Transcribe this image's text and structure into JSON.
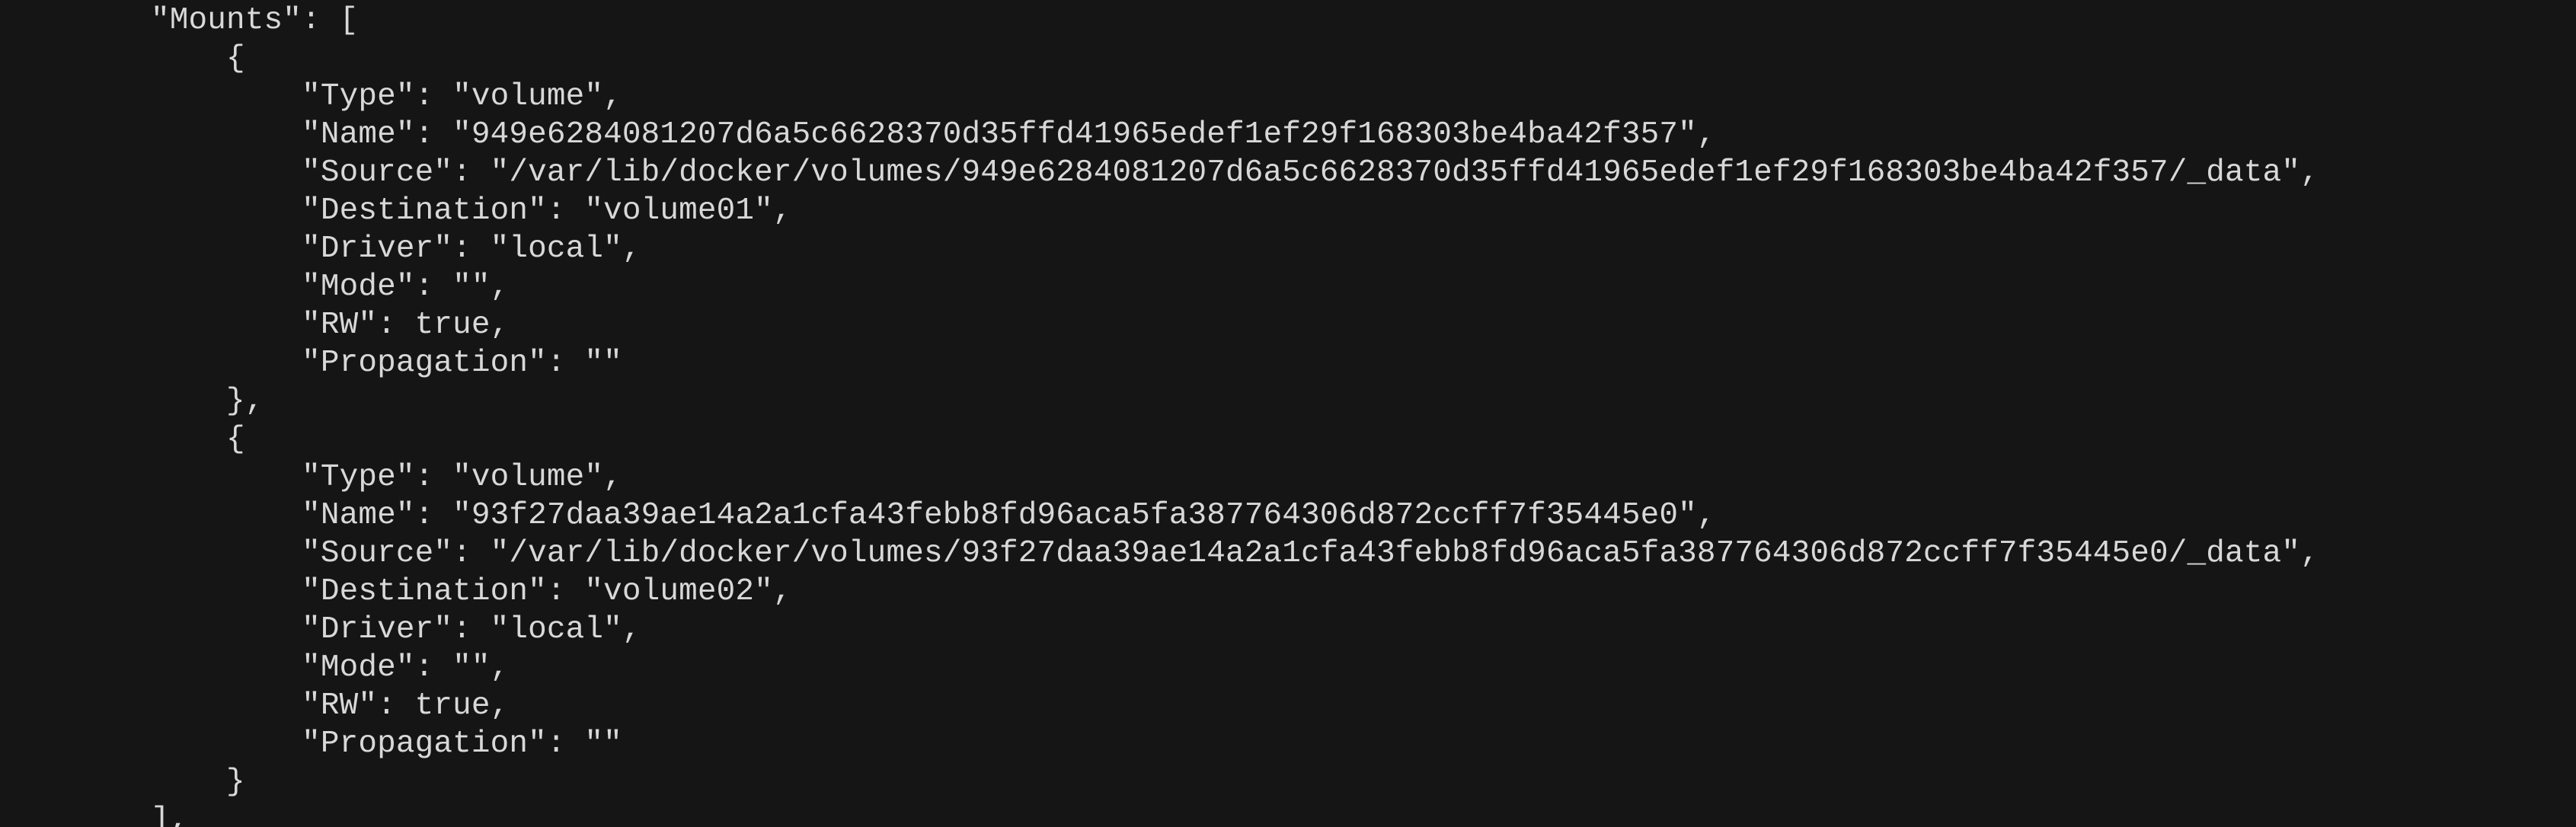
{
  "terminal": {
    "background": "#151515",
    "text_color": "#d8d8d8",
    "lines": [
      "        \"Mounts\": [",
      "            {",
      "                \"Type\": \"volume\",",
      "                \"Name\": \"949e6284081207d6a5c6628370d35ffd41965edef1ef29f168303be4ba42f357\",",
      "                \"Source\": \"/var/lib/docker/volumes/949e6284081207d6a5c6628370d35ffd41965edef1ef29f168303be4ba42f357/_data\",",
      "                \"Destination\": \"volume01\",",
      "                \"Driver\": \"local\",",
      "                \"Mode\": \"\",",
      "                \"RW\": true,",
      "                \"Propagation\": \"\"",
      "            },",
      "            {",
      "                \"Type\": \"volume\",",
      "                \"Name\": \"93f27daa39ae14a2a1cfa43febb8fd96aca5fa387764306d872ccff7f35445e0\",",
      "                \"Source\": \"/var/lib/docker/volumes/93f27daa39ae14a2a1cfa43febb8fd96aca5fa387764306d872ccff7f35445e0/_data\",",
      "                \"Destination\": \"volume02\",",
      "                \"Driver\": \"local\",",
      "                \"Mode\": \"\",",
      "                \"RW\": true,",
      "                \"Propagation\": \"\"",
      "            }",
      "        ],"
    ]
  }
}
